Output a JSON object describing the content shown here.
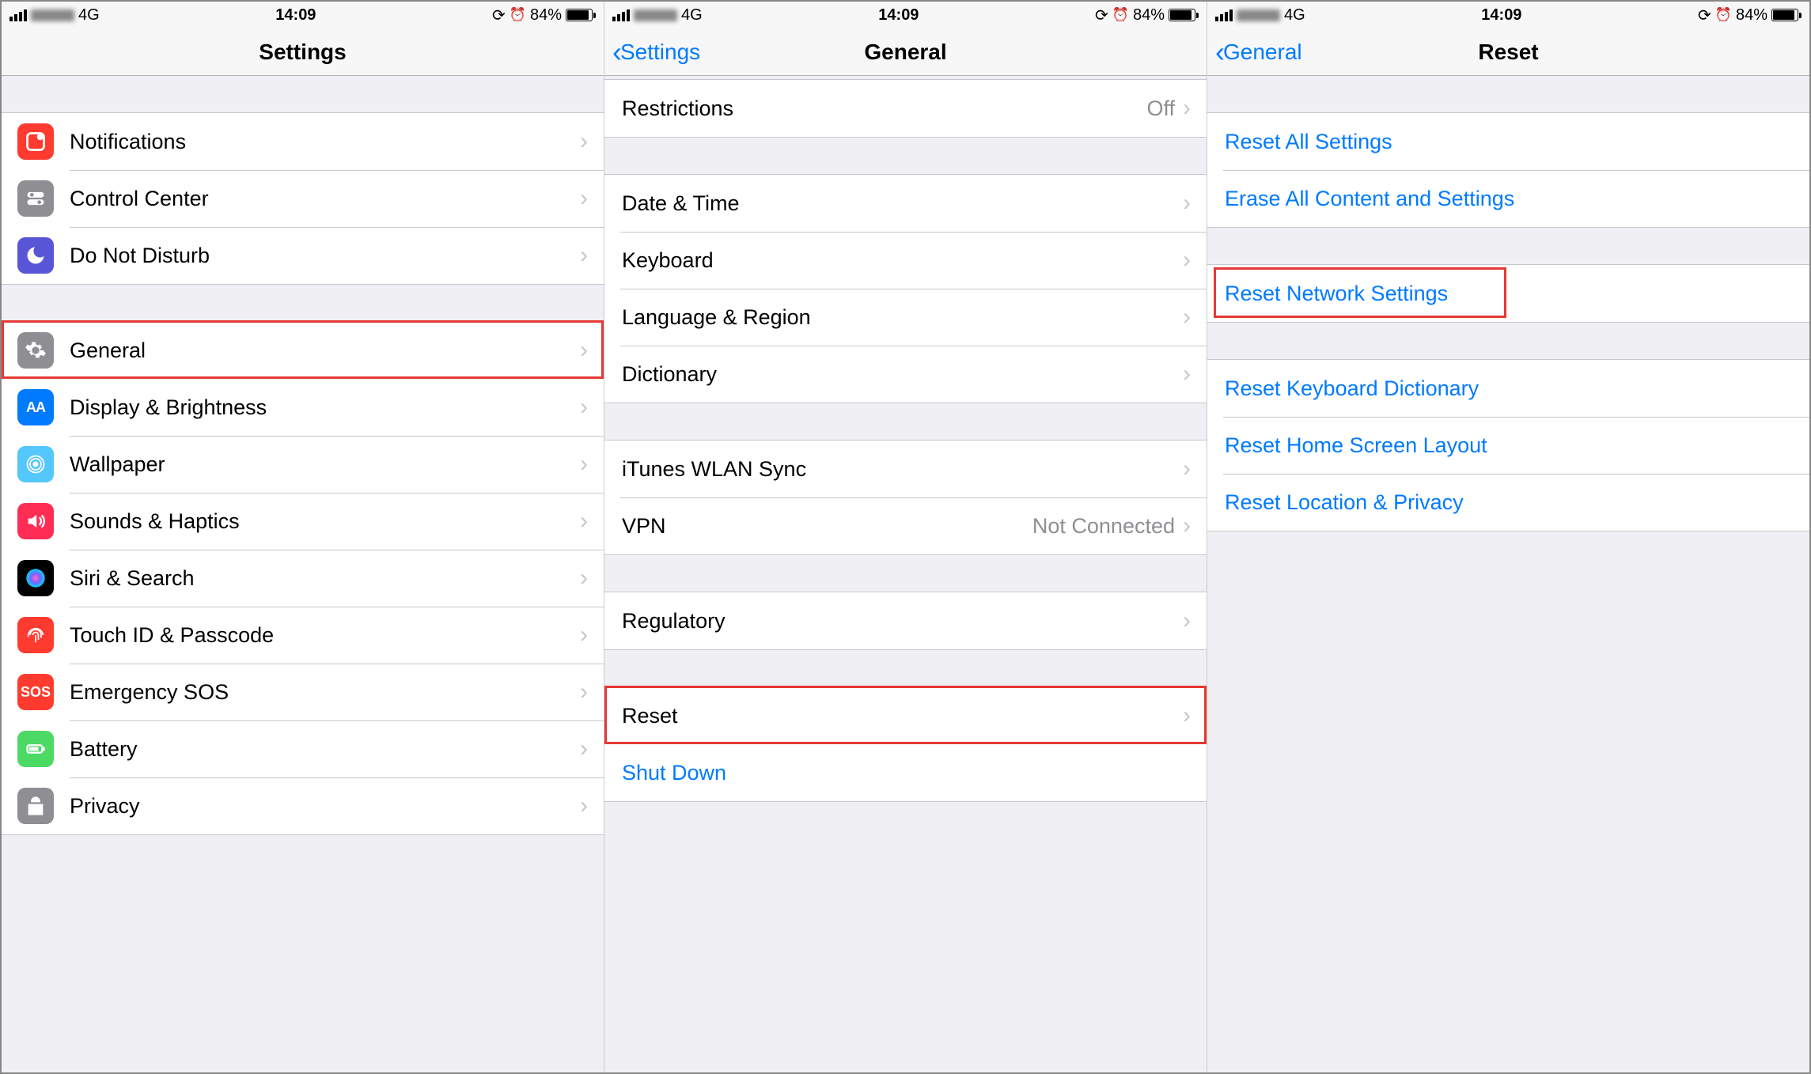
{
  "status": {
    "network": "4G",
    "time": "14:09",
    "battery_pct": "84%"
  },
  "screen1": {
    "title": "Settings",
    "group1": [
      {
        "label": "Notifications",
        "color": "#ff3b30",
        "name": "row-notifications"
      },
      {
        "label": "Control Center",
        "color": "#8e8e93",
        "name": "row-control-center"
      },
      {
        "label": "Do Not Disturb",
        "color": "#5856d6",
        "name": "row-do-not-disturb"
      }
    ],
    "group2": [
      {
        "label": "General",
        "color": "#8e8e93",
        "name": "row-general",
        "highlight": true
      },
      {
        "label": "Display & Brightness",
        "color": "#007aff",
        "name": "row-display-brightness"
      },
      {
        "label": "Wallpaper",
        "color": "#54c7fc",
        "name": "row-wallpaper"
      },
      {
        "label": "Sounds & Haptics",
        "color": "#ff2d55",
        "name": "row-sounds-haptics"
      },
      {
        "label": "Siri & Search",
        "color": "#000",
        "name": "row-siri-search"
      },
      {
        "label": "Touch ID & Passcode",
        "color": "#ff3b30",
        "name": "row-touch-id"
      },
      {
        "label": "Emergency SOS",
        "color": "#ff3b30",
        "name": "row-emergency-sos",
        "text": "SOS"
      },
      {
        "label": "Battery",
        "color": "#4cd964",
        "name": "row-battery"
      },
      {
        "label": "Privacy",
        "color": "#8e8e93",
        "name": "row-privacy"
      }
    ]
  },
  "screen2": {
    "back": "Settings",
    "title": "General",
    "groupA": [
      {
        "label": "Restrictions",
        "value": "Off",
        "name": "row-restrictions"
      }
    ],
    "groupB": [
      {
        "label": "Date & Time",
        "name": "row-date-time"
      },
      {
        "label": "Keyboard",
        "name": "row-keyboard"
      },
      {
        "label": "Language & Region",
        "name": "row-language-region"
      },
      {
        "label": "Dictionary",
        "name": "row-dictionary"
      }
    ],
    "groupC": [
      {
        "label": "iTunes WLAN Sync",
        "name": "row-itunes-wlan-sync"
      },
      {
        "label": "VPN",
        "value": "Not Connected",
        "name": "row-vpn"
      }
    ],
    "groupD": [
      {
        "label": "Regulatory",
        "name": "row-regulatory"
      }
    ],
    "groupE": [
      {
        "label": "Reset",
        "name": "row-reset",
        "highlight": true
      },
      {
        "label": "Shut Down",
        "name": "row-shutdown",
        "blue": true,
        "no_chevron": true
      }
    ]
  },
  "screen3": {
    "back": "General",
    "title": "Reset",
    "group1": [
      {
        "label": "Reset All Settings",
        "name": "row-reset-all-settings"
      },
      {
        "label": "Erase All Content and Settings",
        "name": "row-erase-all"
      }
    ],
    "group2": [
      {
        "label": "Reset Network Settings",
        "name": "row-reset-network",
        "highlight": true
      }
    ],
    "group3": [
      {
        "label": "Reset Keyboard Dictionary",
        "name": "row-reset-keyboard-dict"
      },
      {
        "label": "Reset Home Screen Layout",
        "name": "row-reset-home-layout"
      },
      {
        "label": "Reset Location & Privacy",
        "name": "row-reset-location-privacy"
      }
    ]
  }
}
